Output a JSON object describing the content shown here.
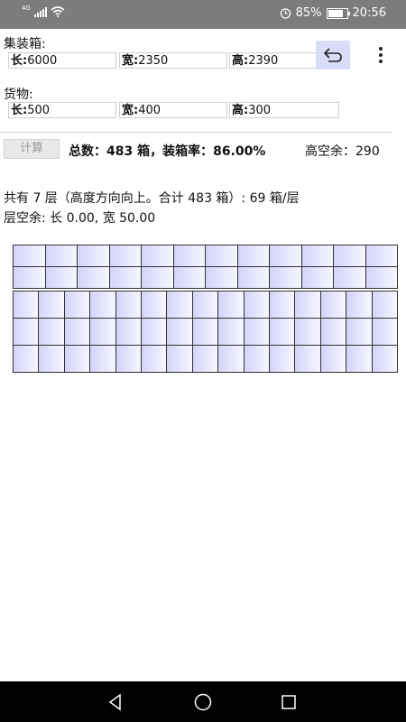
{
  "status_bar": {
    "network": "4G",
    "battery_text": "85%",
    "time": "20:56"
  },
  "container": {
    "title": "集装箱:",
    "length_label": "长:",
    "length_value": "6000",
    "width_label": "宽:",
    "width_value": "2350",
    "height_label": "高:",
    "height_value": "2390"
  },
  "cargo": {
    "title": "货物:",
    "length_label": "长:",
    "length_value": "500",
    "width_label": "宽:",
    "width_value": "400",
    "height_label": "高:",
    "height_value": "300"
  },
  "calc_button_label": "计算",
  "summary_text": "总数：483 箱，装箱率：86.00%",
  "height_remaining_text": "高空余：290",
  "layers_text": "共有 7 层（高度方向向上。合计 483 箱）: 69 箱/层",
  "layer_gap_text": "层空余: 长 0.00, 宽 50.00",
  "layout": {
    "upper_block": {
      "rows": 2,
      "cols": 12
    },
    "lower_block": {
      "rows": 3,
      "cols": 15
    }
  },
  "icons": [
    "undo-icon",
    "more-vert-icon",
    "back-icon",
    "home-icon",
    "recents-icon"
  ]
}
